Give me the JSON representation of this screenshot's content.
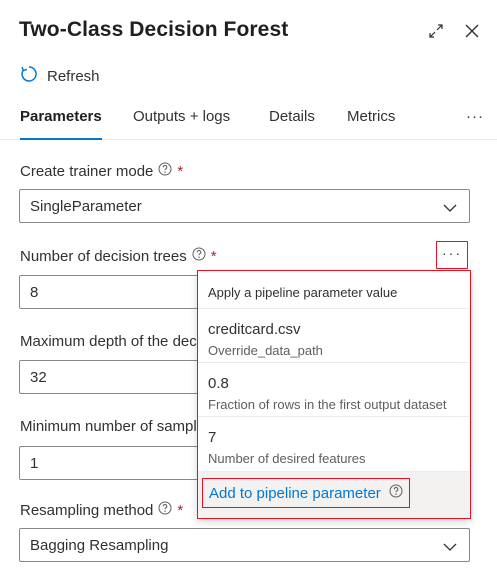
{
  "header": {
    "title": "Two-Class Decision Forest"
  },
  "toolbar": {
    "refresh_label": "Refresh"
  },
  "tabs": [
    {
      "label": "Parameters",
      "active": true
    },
    {
      "label": "Outputs + logs",
      "active": false
    },
    {
      "label": "Details",
      "active": false
    },
    {
      "label": "Metrics",
      "active": false
    }
  ],
  "tabs_more": "···",
  "form": {
    "trainer_mode": {
      "label": "Create trainer mode",
      "required": "*",
      "value": "SinglePara­meter"
    },
    "num_trees": {
      "label": "Number of decision trees",
      "required": "*",
      "value": "8"
    },
    "max_depth": {
      "label": "Maximum depth of the decision trees",
      "value": "32"
    },
    "min_samples": {
      "label": "Minimum number of samples per leaf node",
      "value": "1"
    },
    "resampling": {
      "label": "Resampling method",
      "required": "*",
      "value": "Bagging Resampling"
    }
  },
  "more_button_label": "···",
  "pipeline_dropdown": {
    "header": "Apply a pipeline parameter value",
    "items": [
      {
        "name": "creditcard.csv",
        "description": "Override_data_path"
      },
      {
        "name": "0.8",
        "description": "Fraction of rows in the first output dataset"
      },
      {
        "name": "7",
        "description": "Number of desired features"
      }
    ],
    "add_label": "Add to pipeline parameter"
  },
  "colors": {
    "accent": "#0078d4",
    "highlight_border": "#e81123",
    "required": "#a4262c"
  }
}
